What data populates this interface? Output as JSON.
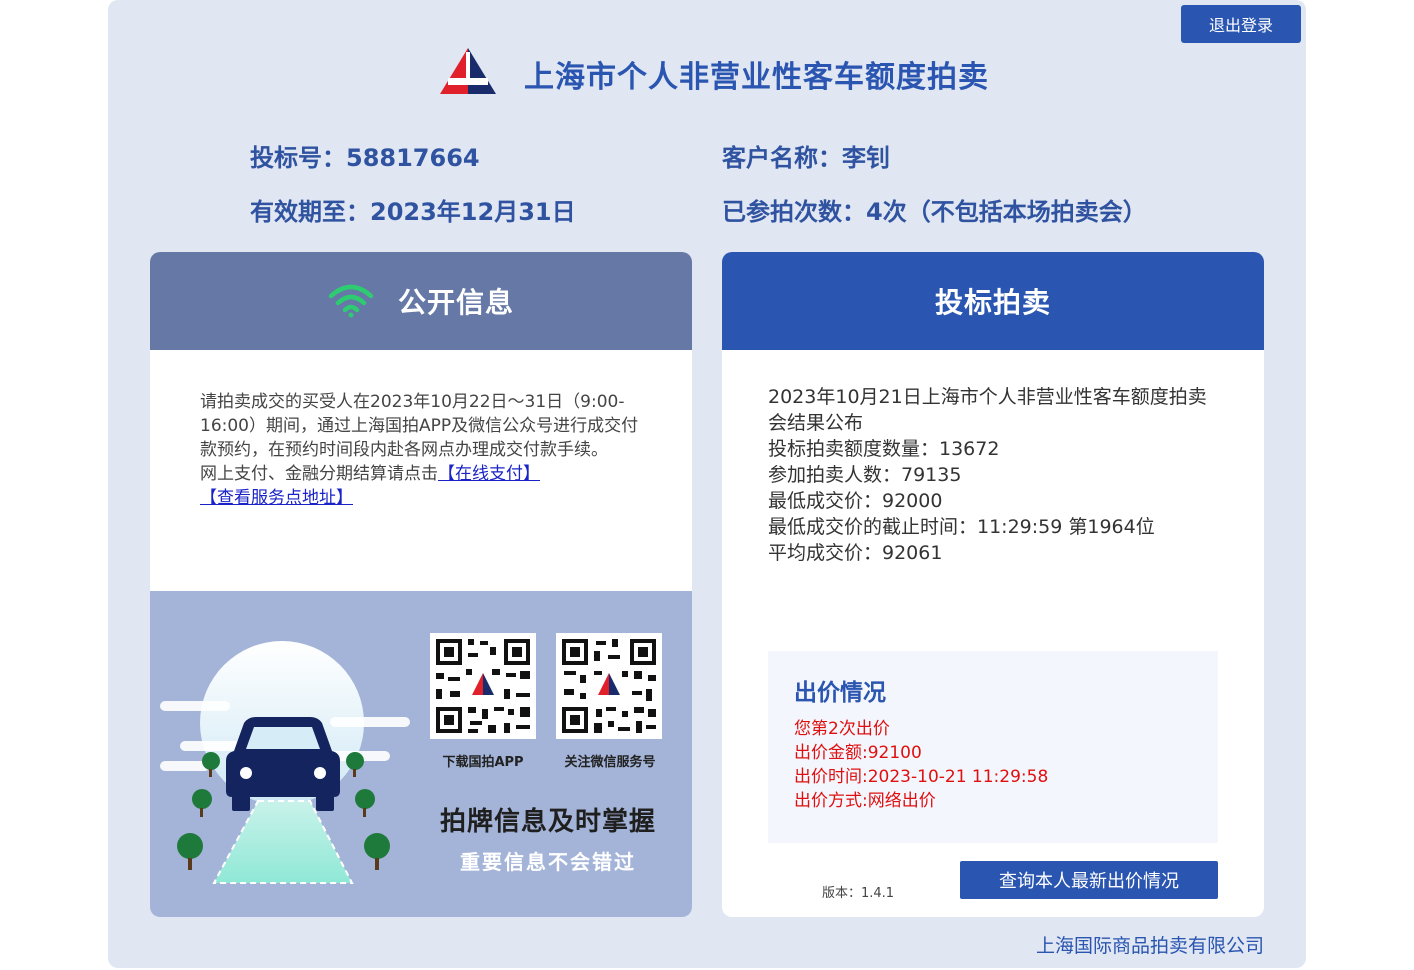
{
  "header": {
    "logout_label": "退出登录",
    "title": "上海市个人非营业性客车额度拍卖"
  },
  "info": {
    "bid_number": "投标号：58817664",
    "customer_name": "客户名称：李钊",
    "valid_until": "有效期至：2023年12月31日",
    "participation_count": "已参拍次数：4次（不包括本场拍卖会）"
  },
  "left_panel": {
    "title": "公开信息",
    "notice_text": "请拍卖成交的买受人在2023年10月22日～31日（9:00-16:00）期间，通过上海国拍APP及微信公众号进行成交付款预约，在预约时间段内赴各网点办理成交付款手续。",
    "payment_prefix": "网上支付、金融分期结算请点击",
    "online_pay_link": "【在线支付】",
    "service_points_link": "【查看服务点地址】",
    "qr_app_label": "下载国拍APP",
    "qr_wechat_label": "关注微信服务号",
    "slogan_main": "拍牌信息及时掌握",
    "slogan_sub": "重要信息不会错过"
  },
  "right_panel": {
    "title": "投标拍卖",
    "result_lines": [
      "2023年10月21日上海市个人非营业性客车额度拍卖会结果公布",
      "投标拍卖额度数量：13672",
      "参加拍卖人数：79135",
      "最低成交价：92000",
      "最低成交价的截止时间：11:29:59 第1964位",
      "平均成交价：92061"
    ],
    "bid_status": {
      "title": "出价情况",
      "lines": [
        "您第2次出价",
        "出价金额:92100",
        "出价时间:2023-10-21 11:29:58",
        "出价方式:网络出价"
      ]
    },
    "version": "版本：1.4.1",
    "query_button": "查询本人最新出价情况"
  },
  "footer": {
    "company": "上海国际商品拍卖有限公司"
  },
  "colors": {
    "brand_blue": "#2a55b0",
    "panel_gray_blue": "#6578a6",
    "promo_bg": "#a4b4d8",
    "alert_red": "#e01010",
    "wifi_green": "#2ecc71"
  }
}
